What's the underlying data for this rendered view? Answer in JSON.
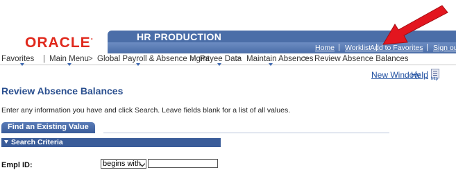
{
  "brand": {
    "logo_text": "ORACLE",
    "logo_mark": "·",
    "app_title": "HR PRODUCTION",
    "accent": "#4b6ea8",
    "logo_color": "#e0281c"
  },
  "top_links": [
    "Home",
    "Worklist",
    "Add to Favorites",
    "Sign out"
  ],
  "top_separator": "|",
  "breadcrumb": {
    "items": [
      "Favorites",
      "Main Menu",
      "Global Payroll & Absence Mgmt",
      "Payee Data",
      "Maintain Absences",
      "Review Absence Balances"
    ],
    "separator": ">"
  },
  "utility_links": {
    "new_window": "New Window",
    "help": "Help",
    "separator": "|",
    "help_icon_label": "http"
  },
  "page": {
    "title": "Review Absence Balances",
    "instructions": "Enter any information you have and click Search. Leave fields blank for a list of all values."
  },
  "tab": {
    "label": "Find an Existing Value"
  },
  "search_criteria": {
    "header": "Search Criteria",
    "fields": [
      {
        "label": "Empl ID:",
        "operator": "begins with",
        "value": ""
      }
    ]
  },
  "annotation": {
    "arrow_color": "#e3161f",
    "icon": "red-arrow-icon"
  }
}
